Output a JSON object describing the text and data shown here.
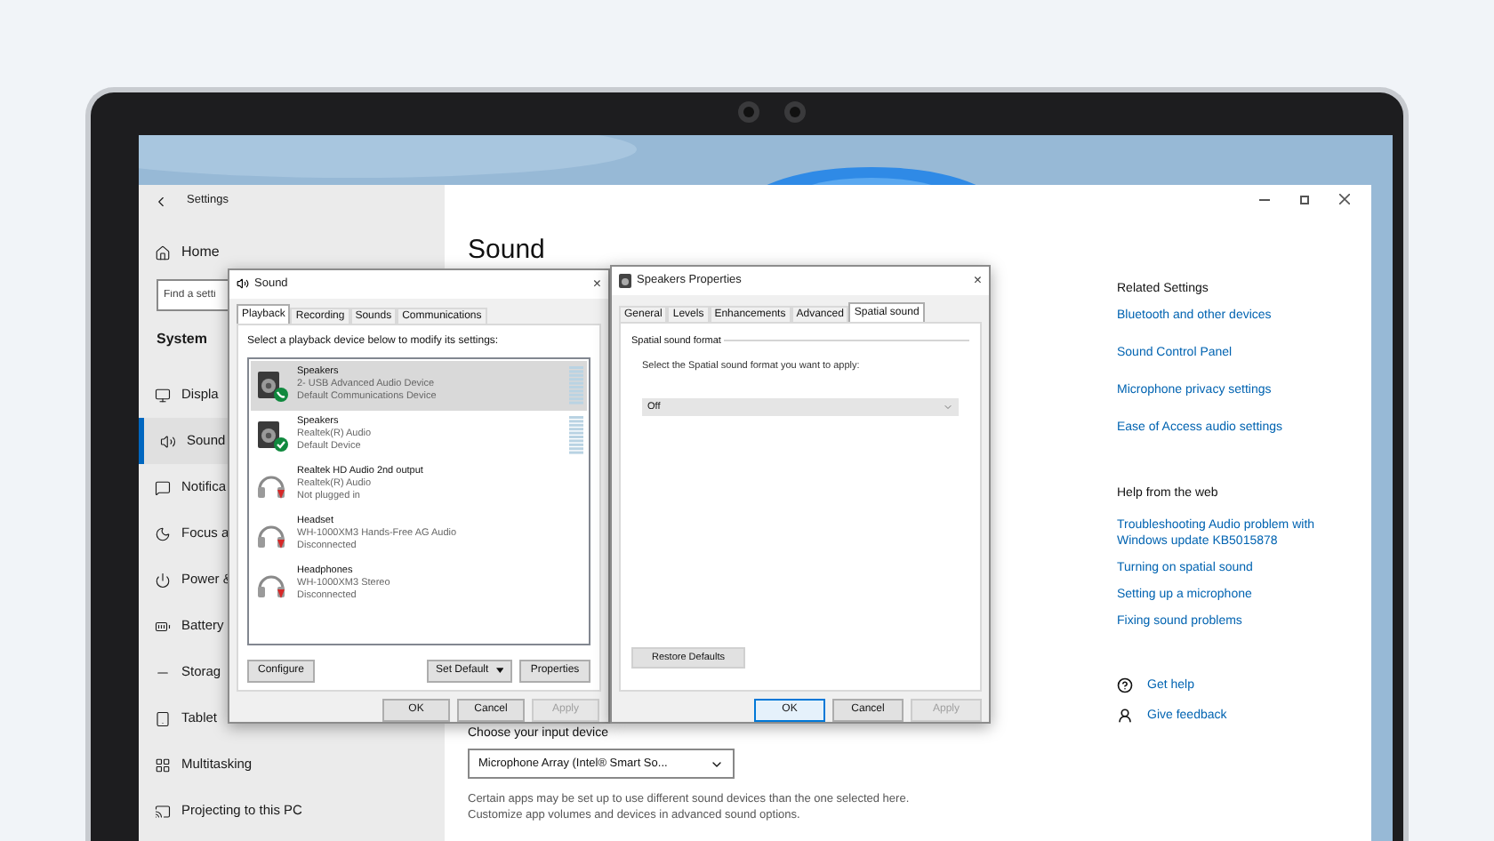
{
  "settings": {
    "title": "Settings",
    "sidebar": {
      "home": "Home",
      "search": {
        "placeholder": "Find a setti"
      },
      "section": "System",
      "items": [
        {
          "label": "Displa",
          "selected": false
        },
        {
          "label": "Sound",
          "selected": true
        },
        {
          "label": "Notifica",
          "selected": false
        },
        {
          "label": "Focus a",
          "selected": false
        },
        {
          "label": "Power &",
          "selected": false
        },
        {
          "label": "Battery",
          "selected": false
        },
        {
          "label": "Storag",
          "selected": false
        },
        {
          "label": "Tablet",
          "selected": false
        },
        {
          "label": "Multitasking",
          "selected": false
        },
        {
          "label": "Projecting to this PC",
          "selected": false
        }
      ]
    },
    "main": {
      "heading": "Sound",
      "input_label": "Choose your input device",
      "input_device": "Microphone Array (Intel® Smart So...",
      "note": "Certain apps may be set up to use different sound devices than the one selected here. Customize app volumes and devices in advanced sound options."
    },
    "related": {
      "title": "Related Settings",
      "links": [
        "Bluetooth and other devices",
        "Sound Control Panel",
        "Microphone privacy settings",
        "Ease of Access audio settings"
      ]
    },
    "help": {
      "title": "Help from the web",
      "links": [
        "Troubleshooting Audio problem with Windows update KB5015878",
        "Turning on spatial sound",
        "Setting up a microphone",
        "Fixing sound problems"
      ]
    },
    "support": [
      {
        "label": "Get help",
        "kind": "help"
      },
      {
        "label": "Give feedback",
        "kind": "feedback"
      }
    ]
  },
  "sound_dialog": {
    "title": "Sound",
    "close": "×",
    "tabs": [
      {
        "label": "Playback",
        "selected": true
      },
      {
        "label": "Recording",
        "selected": false
      },
      {
        "label": "Sounds",
        "selected": false
      },
      {
        "label": "Communications",
        "selected": false
      }
    ],
    "instruction": "Select a playback device below to modify its settings:",
    "devices": [
      {
        "name": "Speakers",
        "driver": "2- USB Advanced Audio Device",
        "status": "Default Communications Device",
        "kind": "speaker",
        "default": true,
        "communications": true,
        "connected": true,
        "meter": true,
        "selected": true
      },
      {
        "name": "Speakers",
        "driver": "Realtek(R) Audio",
        "status": "Default Device",
        "kind": "speaker",
        "default": true,
        "communications": false,
        "connected": true,
        "meter": true,
        "selected": false
      },
      {
        "name": "Realtek HD Audio 2nd output",
        "driver": "Realtek(R) Audio",
        "status": "Not plugged in",
        "kind": "headphones",
        "default": false,
        "communications": false,
        "connected": false,
        "meter": false,
        "selected": false
      },
      {
        "name": "Headset",
        "driver": "WH-1000XM3 Hands-Free AG Audio",
        "status": "Disconnected",
        "kind": "headphones",
        "default": false,
        "communications": false,
        "connected": false,
        "meter": false,
        "selected": false
      },
      {
        "name": "Headphones",
        "driver": "WH-1000XM3 Stereo",
        "status": "Disconnected",
        "kind": "headphones",
        "default": false,
        "communications": false,
        "connected": false,
        "meter": false,
        "selected": false
      }
    ],
    "actions": [
      {
        "label": "Configure",
        "dropdown": false
      },
      {
        "label": "Set Default",
        "dropdown": true
      },
      {
        "label": "Properties",
        "dropdown": false
      }
    ],
    "buttons": [
      {
        "label": "OK",
        "disabled": false,
        "default": false
      },
      {
        "label": "Cancel",
        "disabled": false,
        "default": false
      },
      {
        "label": "Apply",
        "disabled": true,
        "default": false
      }
    ]
  },
  "properties_dialog": {
    "title": "Speakers Properties",
    "close": "×",
    "tabs": [
      {
        "label": "General",
        "selected": false
      },
      {
        "label": "Levels",
        "selected": false
      },
      {
        "label": "Enhancements",
        "selected": false
      },
      {
        "label": "Advanced",
        "selected": false
      },
      {
        "label": "Spatial sound",
        "selected": true
      }
    ],
    "group": "Spatial sound format",
    "instruction": "Select the Spatial sound format you want to apply:",
    "format": "Off",
    "restore": "Restore Defaults",
    "buttons": [
      {
        "label": "OK",
        "disabled": false,
        "default": true
      },
      {
        "label": "Cancel",
        "disabled": false,
        "default": false
      },
      {
        "label": "Apply",
        "disabled": true,
        "default": false
      }
    ]
  }
}
